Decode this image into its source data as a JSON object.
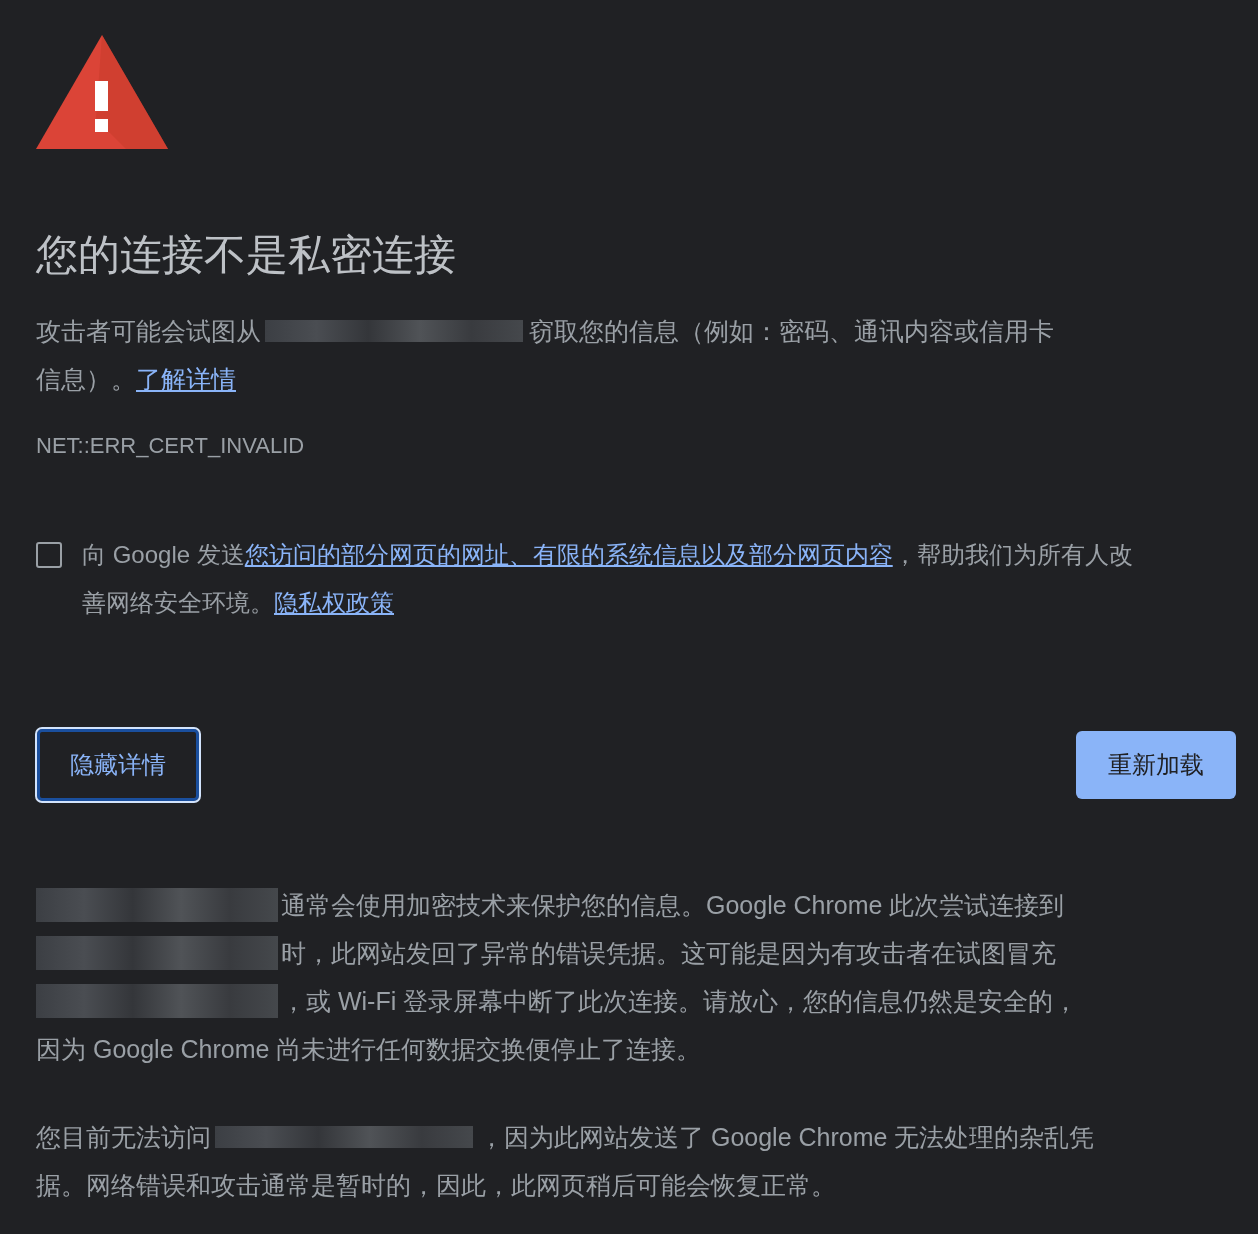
{
  "title": "您的连接不是私密连接",
  "intro": [
    [
      {
        "kind": "text",
        "text": "攻击者可能会试图从"
      },
      {
        "kind": "redacted"
      },
      {
        "kind": "text",
        "text": "窃取您的信息（例如：密码、通讯内容或信用卡"
      }
    ],
    [
      {
        "kind": "text",
        "text": "信息）。"
      },
      {
        "kind": "link",
        "text": "了解详情"
      }
    ]
  ],
  "error_code": "NET::ERR_CERT_INVALID",
  "report": {
    "checked": false,
    "lines": [
      [
        {
          "kind": "text",
          "text": "向 Google 发送"
        },
        {
          "kind": "link",
          "text": "您访问的部分网页的网址、有限的系统信息以及部分网页内容"
        },
        {
          "kind": "text",
          "text": "，帮助我们为所有人改"
        }
      ],
      [
        {
          "kind": "text",
          "text": "善网络安全环境。"
        },
        {
          "kind": "link",
          "text": "隐私权政策"
        }
      ]
    ]
  },
  "buttons": {
    "details": "隐藏详情",
    "reload": "重新加载"
  },
  "details": [
    [
      [
        {
          "kind": "redacted"
        },
        {
          "kind": "text",
          "text": "通常会使用加密技术来保护您的信息。Google Chrome 此次尝试连接到"
        }
      ],
      [
        {
          "kind": "redacted"
        },
        {
          "kind": "text",
          "text": "时，此网站发回了异常的错误凭据。这可能是因为有攻击者在试图冒充"
        }
      ],
      [
        {
          "kind": "redacted"
        },
        {
          "kind": "text",
          "text": "，或 Wi-Fi 登录屏幕中断了此次连接。请放心，您的信息仍然是安全的，"
        }
      ],
      [
        {
          "kind": "text",
          "text": "因为 Google Chrome 尚未进行任何数据交换便停止了连接。"
        }
      ]
    ],
    [
      [
        {
          "kind": "text",
          "text": "您目前无法访问"
        },
        {
          "kind": "redacted"
        },
        {
          "kind": "text",
          "text": "，因为此网站发送了 Google Chrome 无法处理的杂乱凭"
        }
      ],
      [
        {
          "kind": "text",
          "text": "据。网络错误和攻击通常是暂时的，因此，此网页稍后可能会恢复正常。"
        }
      ]
    ]
  ]
}
